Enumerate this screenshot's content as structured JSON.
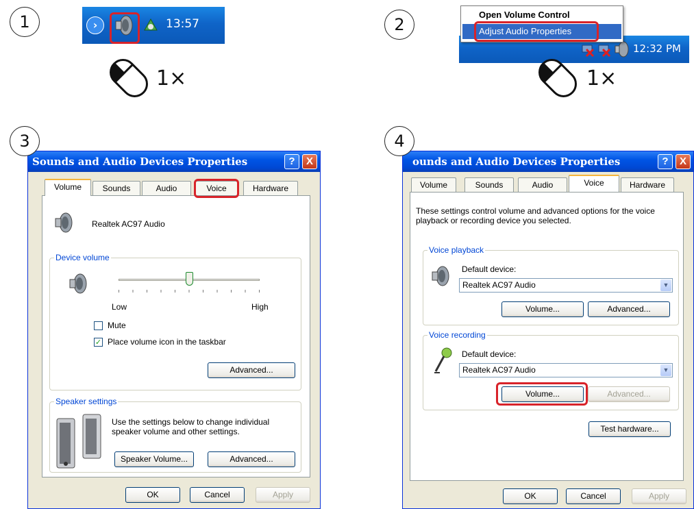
{
  "steps": [
    "1",
    "2",
    "3",
    "4"
  ],
  "panel1": {
    "clock": "13:57",
    "clicks": "1×"
  },
  "panel2": {
    "menu_items": [
      "Open Volume Control",
      "Adjust Audio Properties"
    ],
    "clock": "12:32 PM",
    "clicks": "1×"
  },
  "dialog": {
    "title3": "Sounds and Audio Devices Properties",
    "title4": "ounds and Audio Devices Properties",
    "help": "?",
    "close": "X",
    "tabs": [
      "Volume",
      "Sounds",
      "Audio",
      "Voice",
      "Hardware"
    ],
    "ok": "OK",
    "cancel": "Cancel",
    "apply": "Apply"
  },
  "volume_tab": {
    "device_name": "Realtek AC97 Audio",
    "device_volume_label": "Device volume",
    "low": "Low",
    "high": "High",
    "volume_level": 0.5,
    "mute_label": "Mute",
    "mute_checked": false,
    "taskbar_icon_label": "Place volume icon in the taskbar",
    "taskbar_icon_checked": true,
    "advanced": "Advanced...",
    "speaker_settings_label": "Speaker settings",
    "speaker_text_1": "Use the settings below to change individual",
    "speaker_text_2": "speaker volume and other settings.",
    "speaker_volume": "Speaker Volume...",
    "speaker_advanced": "Advanced..."
  },
  "voice_tab": {
    "intro_1": "These settings control volume and advanced options for the voice",
    "intro_2": "playback or recording device you selected.",
    "playback_label": "Voice playback",
    "recording_label": "Voice recording",
    "default_device": "Default device:",
    "playback_device": "Realtek AC97 Audio",
    "recording_device": "Realtek AC97 Audio",
    "volume": "Volume...",
    "advanced": "Advanced...",
    "test_hardware": "Test hardware..."
  }
}
